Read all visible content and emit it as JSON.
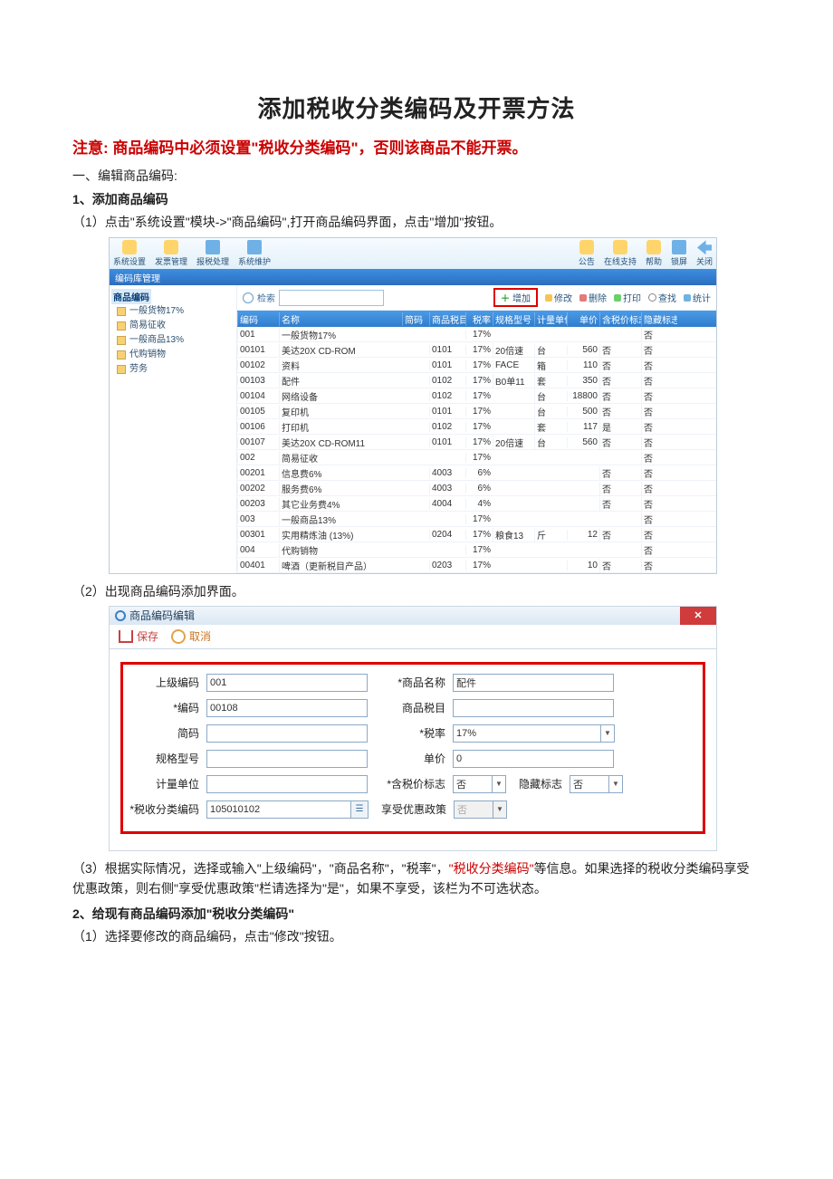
{
  "title": "添加税收分类编码及开票方法",
  "warning_prefix": "注意:",
  "warning_text": "商品编码中必须设置\"税收分类编码\"，否则该商品不能开票。",
  "sec1": "一、编辑商品编码:",
  "sec1_1": "1、添加商品编码",
  "step1_1": "（1）点击\"系统设置\"模块->\"商品编码\",打开商品编码界面，点击\"增加\"按钮。",
  "step1_2": "（2）出现商品编码添加界面。",
  "step1_3a": "（3）根据实际情况，选择或输入\"上级编码\"，\"商品名称\"，\"税率\"，",
  "step1_3_red": "\"税收分类编码\"",
  "step1_3b": "等信息。如果选择的税收分类编码享受优惠政策，则右侧\"享受优惠政策\"栏请选择为\"是\"，如果不享受，该栏为不可选状态。",
  "sec1_2": "2、给现有商品编码添加\"税收分类编码\"",
  "step2_1": "（1）选择要修改的商品编码，点击\"修改\"按钮。",
  "shot1": {
    "top_left": [
      "系统设置",
      "发票管理",
      "报税处理",
      "系统维护"
    ],
    "top_right": [
      "公告",
      "在线支持",
      "帮助",
      "锁屏",
      "关闭"
    ],
    "bluebar": "编码库管理",
    "tree_root": "商品编码",
    "tree": [
      "一般货物17%",
      "简易征收",
      "一般商品13%",
      "代购销物",
      "劳务"
    ],
    "search_label": "检索",
    "btn_add": "增加",
    "btn_mod": "修改",
    "btn_del": "删除",
    "btn_print": "打印",
    "btn_q": "查找",
    "btn_stat": "统计",
    "headers": [
      "编码",
      "名称",
      "简码",
      "商品税目",
      "税率",
      "规格型号",
      "计量单位",
      "单价",
      "含税价标志",
      "隐藏标志"
    ],
    "rows": [
      [
        "001",
        "一般货物17%",
        "",
        "",
        "17%",
        "",
        "",
        "",
        "",
        "否"
      ],
      [
        "00101",
        "美达20X CD-ROM",
        "",
        "0101",
        "17%",
        "20倍速",
        "台",
        "560",
        "否",
        "否"
      ],
      [
        "00102",
        "资料",
        "",
        "0101",
        "17%",
        "FACE",
        "箱",
        "110",
        "否",
        "否"
      ],
      [
        "00103",
        "配件",
        "",
        "0102",
        "17%",
        "B0单11",
        "套",
        "350",
        "否",
        "否"
      ],
      [
        "00104",
        "网络设备",
        "",
        "0102",
        "17%",
        "",
        "台",
        "18800",
        "否",
        "否"
      ],
      [
        "00105",
        "复印机",
        "",
        "0101",
        "17%",
        "",
        "台",
        "500",
        "否",
        "否"
      ],
      [
        "00106",
        "打印机",
        "",
        "0102",
        "17%",
        "",
        "套",
        "117",
        "是",
        "否"
      ],
      [
        "00107",
        "美达20X CD-ROM11",
        "",
        "0101",
        "17%",
        "20倍速",
        "台",
        "560",
        "否",
        "否"
      ],
      [
        "002",
        "简易征收",
        "",
        "",
        "17%",
        "",
        "",
        "",
        "",
        "否"
      ],
      [
        "00201",
        "信息费6%",
        "",
        "4003",
        "6%",
        "",
        "",
        "",
        "否",
        "否"
      ],
      [
        "00202",
        "服务费6%",
        "",
        "4003",
        "6%",
        "",
        "",
        "",
        "否",
        "否"
      ],
      [
        "00203",
        "其它业务费4%",
        "",
        "4004",
        "4%",
        "",
        "",
        "",
        "否",
        "否"
      ],
      [
        "003",
        "一般商品13%",
        "",
        "",
        "17%",
        "",
        "",
        "",
        "",
        "否"
      ],
      [
        "00301",
        "实用精炼油 (13%)",
        "",
        "0204",
        "17%",
        "粮食13",
        "斤",
        "12",
        "否",
        "否"
      ],
      [
        "004",
        "代购销物",
        "",
        "",
        "17%",
        "",
        "",
        "",
        "",
        "否"
      ],
      [
        "00401",
        "啤酒（更新税目产品）",
        "",
        "0203",
        "17%",
        "",
        "",
        "10",
        "否",
        "否"
      ]
    ]
  },
  "shot2": {
    "title": "商品编码编辑",
    "save": "保存",
    "cancel": "取消",
    "labels": {
      "parent": "上级编码",
      "name": "*商品名称",
      "code": "*编码",
      "tax_item": "商品税目",
      "short": "简码",
      "rate": "*税率",
      "spec": "规格型号",
      "price": "单价",
      "unit": "计量单位",
      "inc": "*含税价标志",
      "hide": "隐藏标志",
      "taxclass": "*税收分类编码",
      "policy": "享受优惠政策"
    },
    "values": {
      "parent": "001",
      "name": "配件",
      "code": "00108",
      "tax_item": "",
      "short": "",
      "rate": "17%",
      "spec": "",
      "price": "0",
      "unit": "",
      "inc": "否",
      "hide": "否",
      "taxclass": "105010102",
      "policy": "否"
    }
  }
}
